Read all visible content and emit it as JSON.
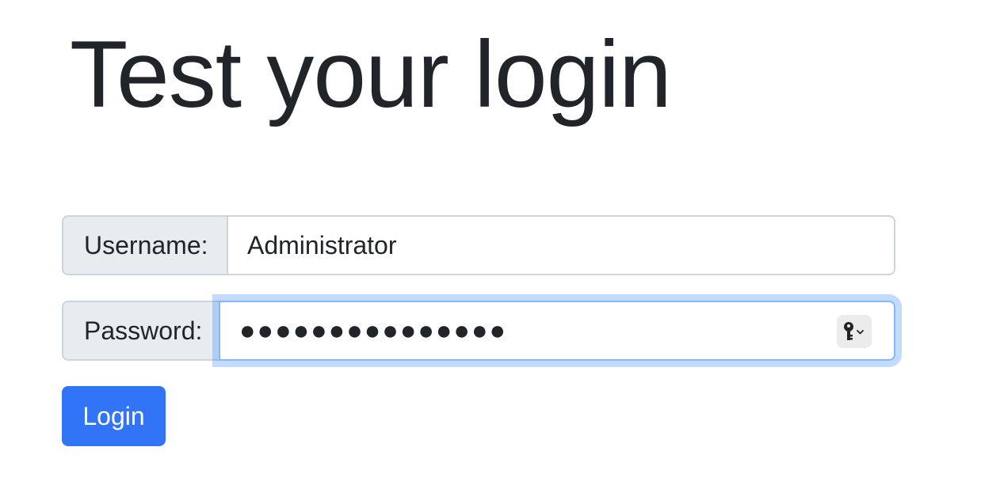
{
  "page": {
    "title": "Test your login"
  },
  "form": {
    "username": {
      "label": "Username:",
      "value": "Administrator"
    },
    "password": {
      "label": "Password:",
      "masked_value": "●●●●●●●●●●●●●●●",
      "autofill_icon": "key-icon"
    },
    "login_button": {
      "label": "Login"
    }
  },
  "colors": {
    "primary": "#3274f6",
    "addon_bg": "#e9ecef",
    "border": "#ced4da",
    "focus_border": "#86b7fe",
    "text": "#212529"
  }
}
